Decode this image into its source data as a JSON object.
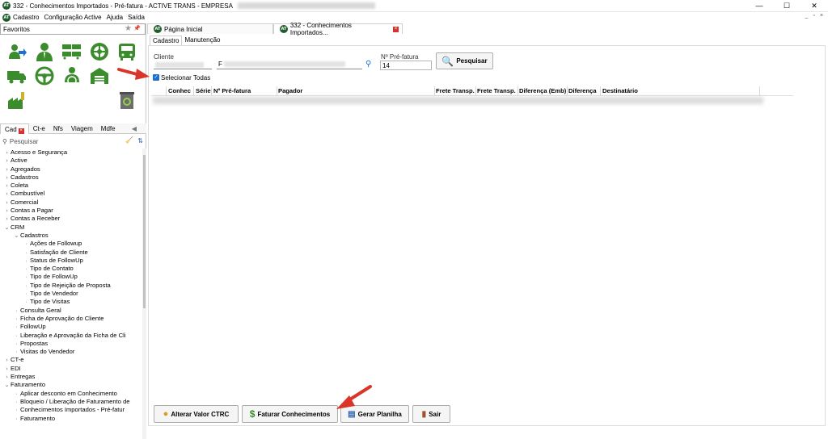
{
  "window": {
    "title": "332 - Conhecimentos Importados - Pré-fatura - ACTIVE TRANS - EMPRESA",
    "minimize": "—",
    "maximize": "☐",
    "close": "✕"
  },
  "menu": {
    "items": [
      "Cadastro",
      "Configuração Active",
      "Ajuda",
      "Saída"
    ],
    "mdi_controls": [
      "_",
      "▫",
      "×"
    ]
  },
  "favorites": {
    "title": "Favoritos",
    "icons": [
      "user-arrow-icon",
      "person-icon",
      "trucks-icon",
      "wheel-icon",
      "bus-icon",
      "truck-icon",
      "steering-wheel-icon",
      "driver-icon",
      "warehouse-icon",
      "",
      "factory-icon",
      "",
      "",
      "",
      "recycle-bin-icon"
    ]
  },
  "left_tabs": [
    "Cad",
    "Ct-e",
    "Nfs",
    "Viagem",
    "Mdfe"
  ],
  "left_search": {
    "placeholder": "Pesquisar"
  },
  "tree": [
    {
      "label": "Acesso e Segurança",
      "level": 0,
      "state": "closed"
    },
    {
      "label": "Active",
      "level": 0,
      "state": "closed"
    },
    {
      "label": "Agregados",
      "level": 0,
      "state": "closed"
    },
    {
      "label": "Cadastros",
      "level": 0,
      "state": "closed"
    },
    {
      "label": "Coleta",
      "level": 0,
      "state": "closed"
    },
    {
      "label": "Combustível",
      "level": 0,
      "state": "closed"
    },
    {
      "label": "Comercial",
      "level": 0,
      "state": "closed"
    },
    {
      "label": "Contas a Pagar",
      "level": 0,
      "state": "closed"
    },
    {
      "label": "Contas a Receber",
      "level": 0,
      "state": "closed"
    },
    {
      "label": "CRM",
      "level": 0,
      "state": "open"
    },
    {
      "label": "Cadastros",
      "level": 1,
      "state": "open"
    },
    {
      "label": "Ações de Followup",
      "level": 2,
      "state": "leaf"
    },
    {
      "label": "Satisfação de Cliente",
      "level": 2,
      "state": "leaf"
    },
    {
      "label": "Status de FollowUp",
      "level": 2,
      "state": "leaf"
    },
    {
      "label": "Tipo de Contato",
      "level": 2,
      "state": "leaf"
    },
    {
      "label": "Tipo de FollowUp",
      "level": 2,
      "state": "leaf"
    },
    {
      "label": "Tipo de Rejeição de Proposta",
      "level": 2,
      "state": "leaf"
    },
    {
      "label": "Tipo de Vendedor",
      "level": 2,
      "state": "leaf"
    },
    {
      "label": "Tipo de Visitas",
      "level": 2,
      "state": "leaf"
    },
    {
      "label": "Consulta Geral",
      "level": 1,
      "state": "leaf"
    },
    {
      "label": "Ficha de Aprovação do Cliente",
      "level": 1,
      "state": "leaf"
    },
    {
      "label": "FollowUp",
      "level": 1,
      "state": "leaf"
    },
    {
      "label": "Liberação e Aprovação da Ficha de Cli",
      "level": 1,
      "state": "leaf"
    },
    {
      "label": "Propostas",
      "level": 1,
      "state": "leaf"
    },
    {
      "label": "Visitas do Vendedor",
      "level": 1,
      "state": "leaf"
    },
    {
      "label": "CT-e",
      "level": 0,
      "state": "closed"
    },
    {
      "label": "EDI",
      "level": 0,
      "state": "closed"
    },
    {
      "label": "Entregas",
      "level": 0,
      "state": "closed"
    },
    {
      "label": "Faturamento",
      "level": 0,
      "state": "open"
    },
    {
      "label": "Aplicar desconto em Conhecimento",
      "level": 1,
      "state": "leaf"
    },
    {
      "label": "Bloqueio / Liberação de Faturamento de",
      "level": 1,
      "state": "leaf"
    },
    {
      "label": "Conhecimentos Importados - Pré-fatur",
      "level": 1,
      "state": "leaf"
    },
    {
      "label": "Faturamento",
      "level": 1,
      "state": "leaf"
    }
  ],
  "doc_tabs": [
    {
      "label": "Página Inicial"
    },
    {
      "label": "332 - Conhecimentos Importados..."
    }
  ],
  "sub_tabs": [
    "Cadastro",
    "Manutenção"
  ],
  "form": {
    "cliente_label": "Cliente",
    "cliente_prefix": "F",
    "prefatura_label": "Nº Pré-fatura",
    "prefatura_value": "14",
    "pesquisar_label": "Pesquisar",
    "selecionar_label": "Selecionar Todas"
  },
  "grid": {
    "columns": [
      "Conhec",
      "Série",
      "Nº Pré-fatura",
      "Pagador",
      "Frete Transp.",
      "Frete Transp.",
      "Diferença (Emb)",
      "Diferença",
      "Destinatário"
    ]
  },
  "actions": {
    "alterar": "Alterar Valor CTRC",
    "faturar": "Faturar Conhecimentos",
    "gerar": "Gerar Planilha",
    "sair": "Sair"
  },
  "colors": {
    "accent": "#1e6fd0",
    "logo": "#1f5c2b",
    "arrow": "#d9352b",
    "icon_green": "#3b8c2c"
  }
}
